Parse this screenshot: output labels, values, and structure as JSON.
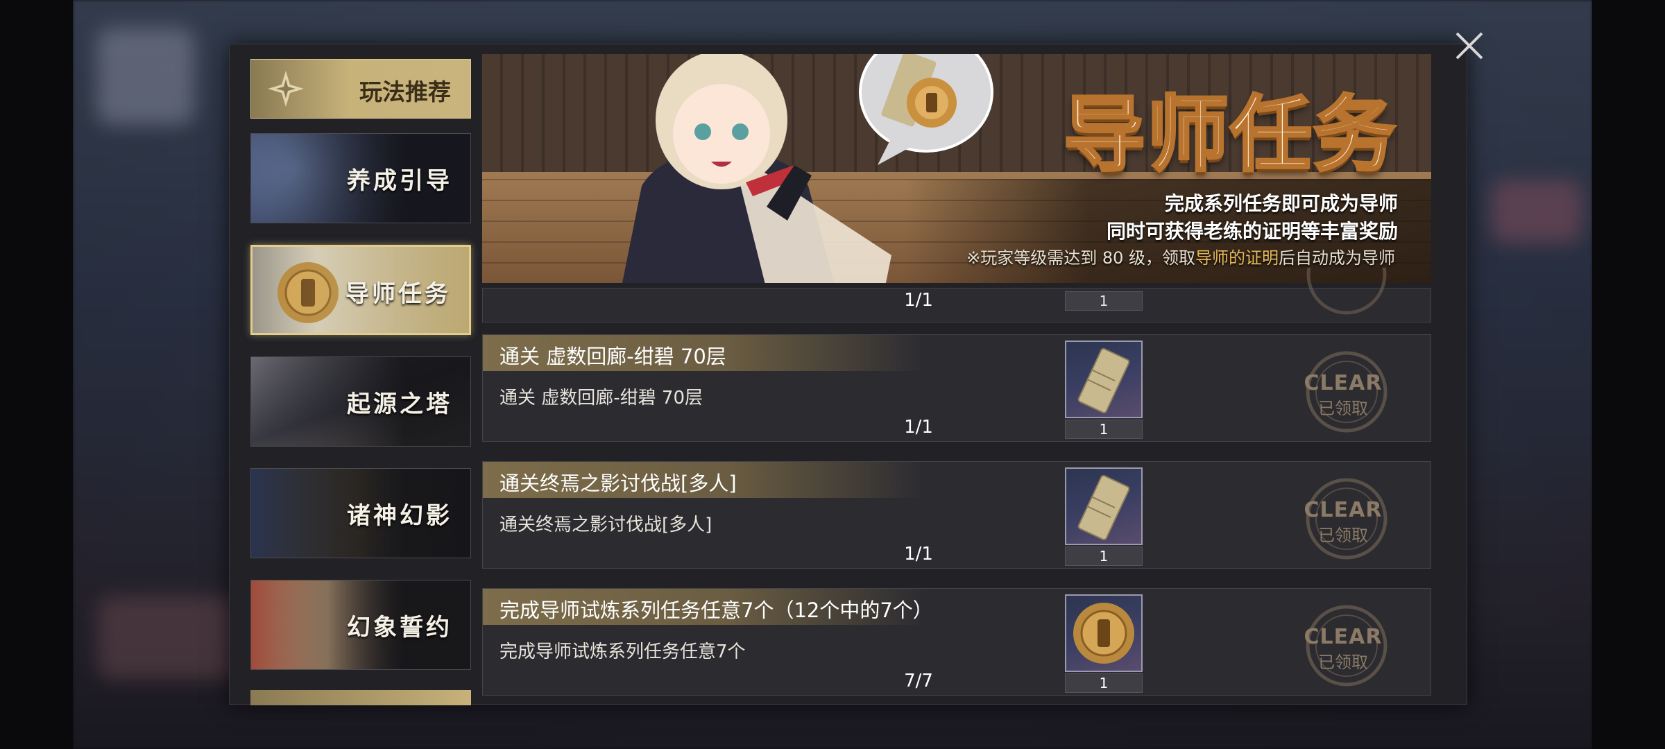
{
  "nav": {
    "header": "玩法推荐",
    "items": [
      {
        "label": "养成引导",
        "active": false,
        "icon": "training-art"
      },
      {
        "label": "导师任务",
        "active": true,
        "icon": "mentor-seal-art"
      },
      {
        "label": "起源之塔",
        "active": false,
        "icon": "tower-art"
      },
      {
        "label": "诸神幻影",
        "active": false,
        "icon": "gods-art"
      },
      {
        "label": "幻象誓约",
        "active": false,
        "icon": "oath-art"
      }
    ]
  },
  "banner": {
    "title": "导师任务",
    "line1": "完成系列任务即可成为导师",
    "line2": "同时可获得老练的证明等丰富奖励",
    "note_prefix": "※玩家等级需达到 80 级，领取",
    "note_highlight": "导师的证明",
    "note_suffix": "后自动成为导师"
  },
  "partial_task": {
    "progress": "1/1",
    "reward_count": "1"
  },
  "tasks": [
    {
      "title": "通关 虚数回廊-绀碧 70层",
      "desc": "通关 虚数回廊-绀碧 70层",
      "progress": "1/1",
      "reward_icon": "certificate-scroll-icon",
      "reward_count": "1",
      "stamp_top": "CLEAR",
      "stamp_bottom": "已领取"
    },
    {
      "title": "通关终焉之影讨伐战[多人]",
      "desc": "通关终焉之影讨伐战[多人]",
      "progress": "1/1",
      "reward_icon": "certificate-scroll-icon",
      "reward_count": "1",
      "stamp_top": "CLEAR",
      "stamp_bottom": "已领取"
    },
    {
      "title": "完成导师试炼系列任务任意7个（12个中的7个）",
      "desc": "完成导师试炼系列任务任意7个",
      "progress": "7/7",
      "reward_icon": "gold-seal-icon",
      "reward_count": "1",
      "stamp_top": "CLEAR",
      "stamp_bottom": "已领取"
    }
  ],
  "colors": {
    "accent_gold": "#c7b27a",
    "panel_bg": "#212126",
    "stamp": "#8b7a66",
    "title_stroke": "#b8742e"
  }
}
